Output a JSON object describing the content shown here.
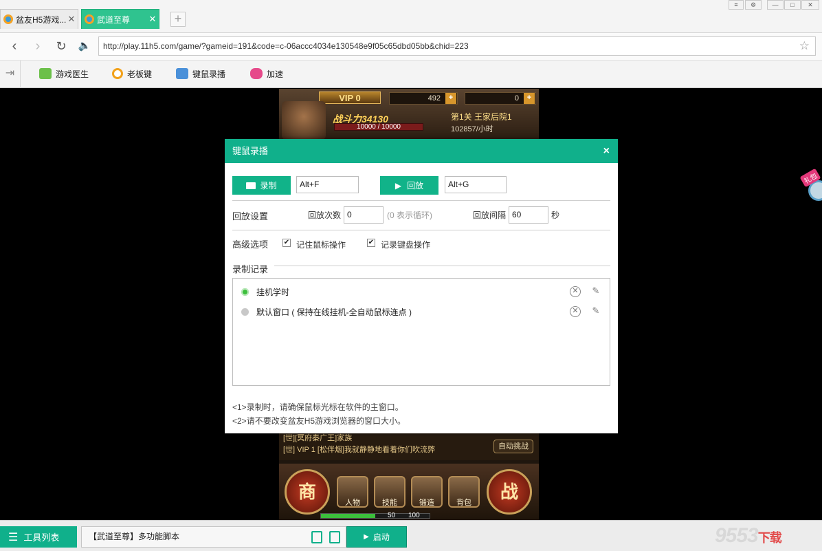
{
  "tabs": [
    {
      "title": "盆友H5游戏...",
      "active": false
    },
    {
      "title": "武道至尊",
      "active": true
    }
  ],
  "new_tab_symbol": "+",
  "address": {
    "url": "http://play.11h5.com/game/?gameid=191&code=c-06accc4034e130548e9f05c65dbd05bb&chid=223"
  },
  "toolbar": {
    "items": [
      {
        "label": "游戏医生",
        "icon": "medkit-icon",
        "color": "#6cc04a"
      },
      {
        "label": "老板键",
        "icon": "eye-icon",
        "color": "#f2a11a"
      },
      {
        "label": "键鼠录播",
        "icon": "keyboard-icon",
        "color": "#4a90d9"
      },
      {
        "label": "加速",
        "icon": "gamepad-icon",
        "color": "#e64a8a"
      }
    ]
  },
  "game": {
    "vip": "VIP 0",
    "gold": "492",
    "ingot": "0",
    "power": "战斗力34130",
    "hp": "10000 / 10000",
    "stage": "第1关 王家后院1",
    "rate": "102857/小时",
    "chat": [
      "[世][冥府秦广王]家族",
      "[世] VIP 1 [松伴烟]我就静静地看着你们吹流弊"
    ],
    "auto_challenge": "自动挑战",
    "shop": "商",
    "battle": "战",
    "menu": [
      "人物",
      "技能",
      "锻造",
      "背包"
    ],
    "exp_left": "50",
    "exp_right": "100"
  },
  "gift_badge": "礼包",
  "dialog": {
    "title": "键鼠录播",
    "close": "×",
    "record_label": "录制",
    "record_key": "Alt+F",
    "play_label": "回放",
    "play_key": "Alt+G",
    "playback_settings": "回放设置",
    "play_count_label": "回放次数",
    "play_count_value": "0",
    "loop_hint": "(0 表示循环)",
    "interval_label": "回放间隔",
    "interval_value": "60",
    "interval_unit": "秒",
    "advanced": "高级选项",
    "opt_mouse": "记住鼠标操作",
    "opt_keyboard": "记录键盘操作",
    "records_title": "录制记录",
    "records": [
      {
        "name": "挂机学时",
        "active": true
      },
      {
        "name": "默认窗口 ( 保持在线挂机-全自动鼠标连点 )",
        "active": false
      }
    ],
    "note1": "<1>录制时，请确保鼠标光标在软件的主窗口。",
    "note2": "<2>请不要改变盆友H5游戏浏览器的窗口大小。"
  },
  "status": {
    "tool_list": "工具列表",
    "script": "【武道至尊】多功能脚本",
    "start": "启动"
  },
  "watermark": {
    "num": "9553",
    "dl": "下载"
  }
}
